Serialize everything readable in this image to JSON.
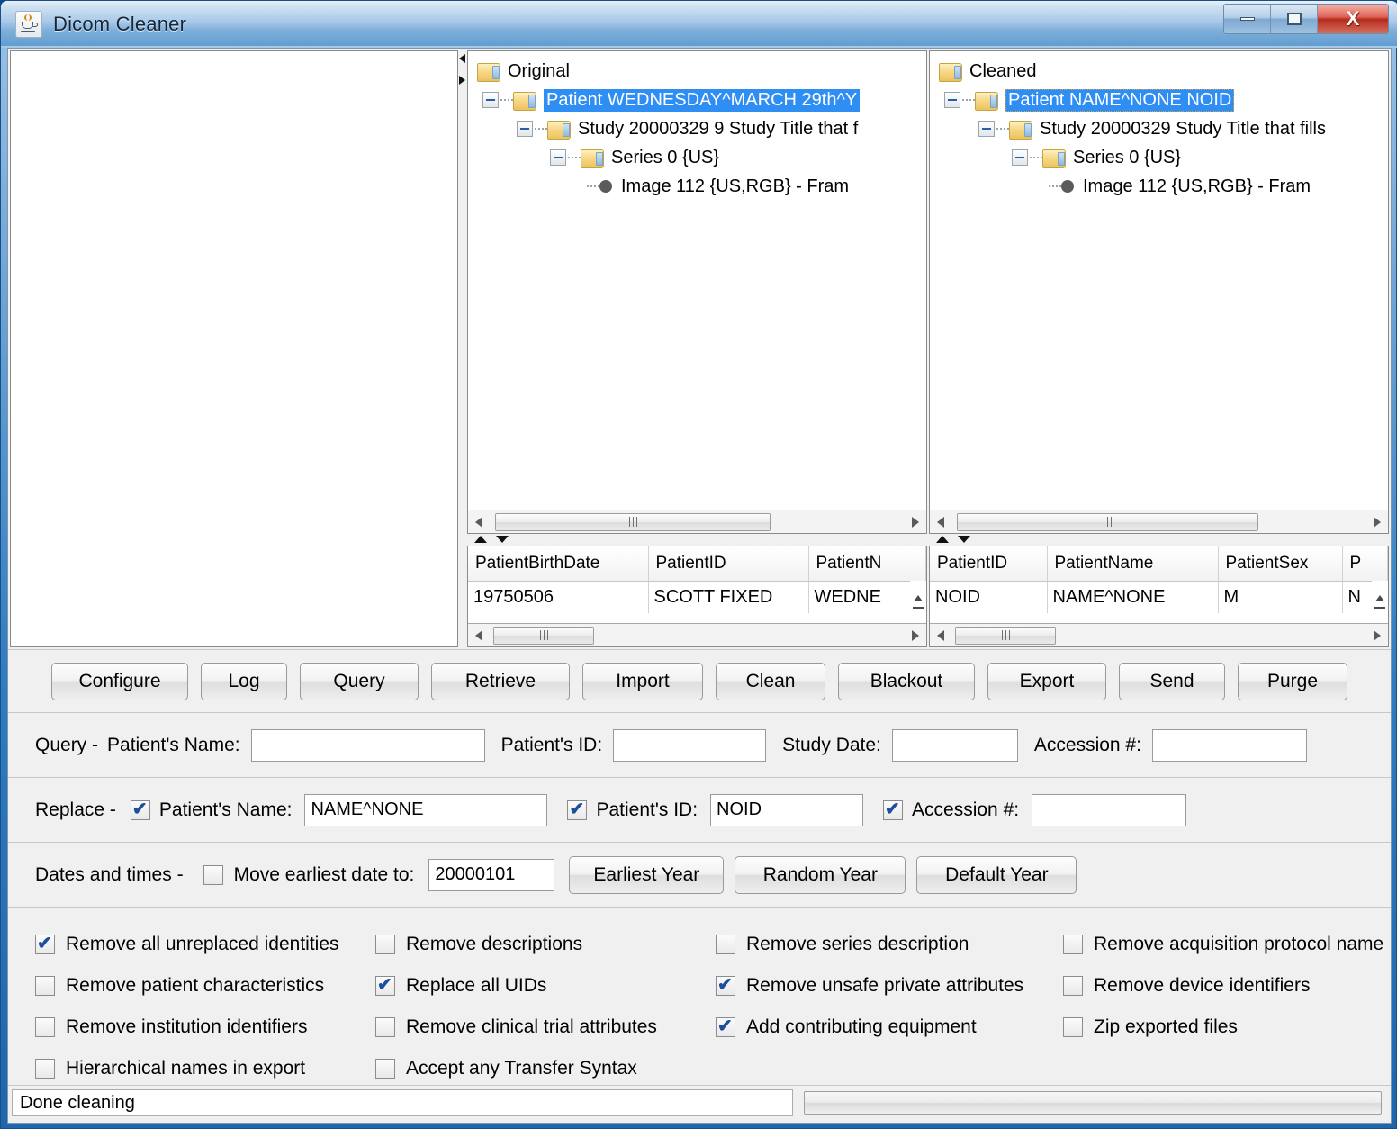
{
  "window": {
    "title": "Dicom Cleaner",
    "icon": "java-coffee-cup-icon",
    "minimize_label": "",
    "maximize_label": "",
    "close_label": "X"
  },
  "trees": {
    "original": {
      "root": "Original",
      "nodes": [
        "Patient WEDNESDAY^MARCH 29th^Y",
        "Study 20000329 9 Study Title that f",
        "Series 0 {US}",
        "Image 112 {US,RGB} - Fram"
      ],
      "selected_index": 0
    },
    "cleaned": {
      "root": "Cleaned",
      "nodes": [
        "Patient NAME^NONE NOID",
        "Study 20000329 Study Title that fills",
        "Series 0 {US}",
        "Image 112 {US,RGB} - Fram"
      ],
      "selected_index": 0
    }
  },
  "tables": {
    "original": {
      "columns": [
        "PatientBirthDate",
        "PatientID",
        "PatientN"
      ],
      "rows": [
        [
          "19750506",
          "SCOTT FIXED",
          "WEDNE"
        ]
      ]
    },
    "cleaned": {
      "columns": [
        "PatientID",
        "PatientName",
        "PatientSex",
        "P"
      ],
      "rows": [
        [
          "NOID",
          "NAME^NONE",
          "M",
          "N"
        ]
      ]
    }
  },
  "buttons": [
    "Configure",
    "Log",
    "Query",
    "Retrieve",
    "Import",
    "Clean",
    "Blackout",
    "Export",
    "Send",
    "Purge"
  ],
  "query": {
    "prefix": "Query -",
    "patient_name_label": "Patient's Name:",
    "patient_name_value": "",
    "patient_id_label": "Patient's ID:",
    "patient_id_value": "",
    "study_date_label": "Study Date:",
    "study_date_value": "",
    "accession_label": "Accession #:",
    "accession_value": ""
  },
  "replace": {
    "prefix": "Replace -",
    "patient_name_label": "Patient's Name:",
    "patient_name_checked": true,
    "patient_name_value": "NAME^NONE",
    "patient_id_label": "Patient's ID:",
    "patient_id_checked": true,
    "patient_id_value": "NOID",
    "accession_label": "Accession #:",
    "accession_checked": true,
    "accession_value": ""
  },
  "dates": {
    "prefix": "Dates and times -",
    "move_label": "Move earliest date to:",
    "move_checked": false,
    "move_value": "20000101",
    "earliest_year_button": "Earliest Year",
    "random_year_button": "Random Year",
    "default_year_button": "Default Year"
  },
  "options": [
    {
      "label": "Remove all unreplaced identities",
      "checked": true
    },
    {
      "label": "Remove descriptions",
      "checked": false
    },
    {
      "label": "Remove series description",
      "checked": false
    },
    {
      "label": "Remove acquisition protocol name",
      "checked": false
    },
    {
      "label": "Remove patient characteristics",
      "checked": false
    },
    {
      "label": "Replace all UIDs",
      "checked": true
    },
    {
      "label": "Remove unsafe private attributes",
      "checked": true
    },
    {
      "label": "Remove device identifiers",
      "checked": false
    },
    {
      "label": "Remove institution identifiers",
      "checked": false
    },
    {
      "label": "Remove clinical trial attributes",
      "checked": false
    },
    {
      "label": "Add contributing equipment",
      "checked": true
    },
    {
      "label": "Zip exported files",
      "checked": false
    },
    {
      "label": "Hierarchical names in export",
      "checked": false
    },
    {
      "label": "Accept any Transfer Syntax",
      "checked": false
    },
    {
      "label": "",
      "checked": false
    },
    {
      "label": "",
      "checked": false
    }
  ],
  "status": {
    "message": "Done cleaning",
    "progress_percent": 0
  },
  "colors": {
    "selection_blue": "#2f8ef4",
    "title_blue": "#2f7cc0",
    "panel_gray": "#f0f0f0"
  }
}
